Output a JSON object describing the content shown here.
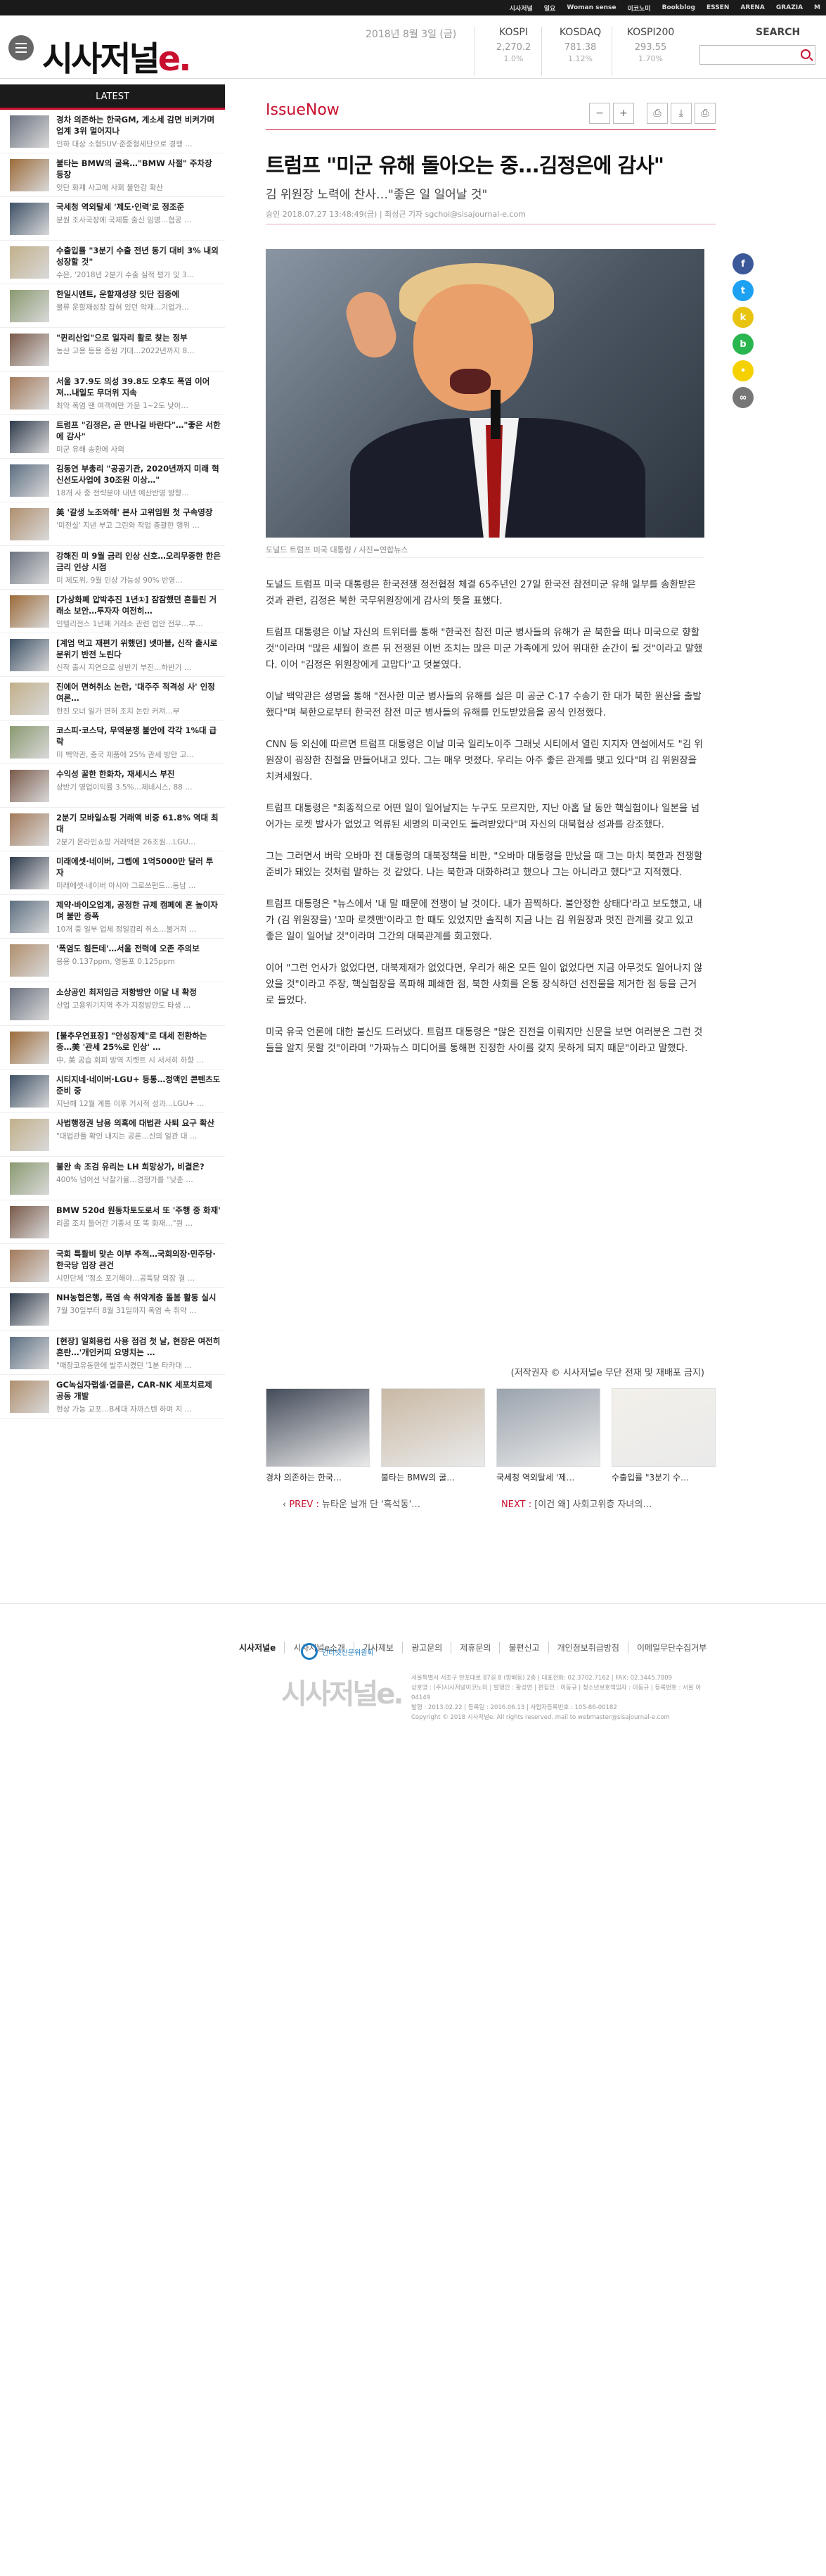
{
  "network_links": [
    "시사저널",
    "일요",
    "Woman sense",
    "이코노미",
    "Bookblog",
    "ESSEN",
    "ARENA",
    "GRAZIA",
    "M"
  ],
  "header": {
    "logo_main": "시사저널",
    "logo_accent": "e.",
    "date": "2018년 8월 3일 (금)",
    "search_title": "SEARCH",
    "search_placeholder": ""
  },
  "markets": [
    {
      "name": "KOSPI",
      "value": "2,270.2",
      "change": "1.0%"
    },
    {
      "name": "KOSDAQ",
      "value": "781.38",
      "change": "1.12%"
    },
    {
      "name": "KOSPI200",
      "value": "293.55",
      "change": "1.70%"
    }
  ],
  "sidebar": {
    "title": "LATEST",
    "items": [
      {
        "title": "경차 의존하는 한국GM, 계소세 감면 비켜가며 업계 3위 멀어지나",
        "summary": "인하 대상 소형SUV·준중형세단으로 경쟁 …"
      },
      {
        "title": "불타는 BMW의 굴욕…\"BMW 사절\" 주차장 등장",
        "summary": "잇단 화재 사고에 사회 불안감 확산"
      },
      {
        "title": "국세청 역외탈세 '제도·인력'로 정조준",
        "summary": "분원 조사국장에 국제통 출신 임명…협공 …"
      },
      {
        "title": "수출입률 \"3분기 수출 전년 동기 대비 3% 내외 성장할 것\"",
        "summary": "수은, '2018년 2분기 수출 실적 평가 및 3…"
      },
      {
        "title": "한일시멘트, 운할재성장 잇단 집중에",
        "summary": "물류 운할재성장 잡혀 있던 악재…기업가…"
      },
      {
        "title": "\"퀸리산업\"으로 일자리 활로 찾는 정부",
        "summary": "농산 고용 등용 증원 기대…2022년까지 8…"
      },
      {
        "title": "서울 37.9도 의성 39.8도 오후도 폭염 이어져…내일도 무더위 지속",
        "summary": "최악 폭염 땐 여객에만 가운 1~2도 낮아…"
      },
      {
        "title": "트럼프 \"김정은, 곧 만나길 바란다\"…\"좋은 서한 에 감사\"",
        "summary": "미군 유해 송환에 사의"
      },
      {
        "title": "김동연 부총리 \"공공기관, 2020년까지 미래 혁신선도사업에 30조원 이상…\"",
        "summary": "18개 사 중 전략분야 내년 예산반영 방향…"
      },
      {
        "title": "美 '갈생 노조와해' 본사 고위임원 첫 구속영장",
        "summary": "'미전실' 지낸 부고 그린와 작업 총괄한 행위 …"
      },
      {
        "title": "강해진 미 9월 금리 인상 신호…오리무중한 한은 금리 인상 시점",
        "summary": "미 제도위, 9월 인상 가능성 90% 반영…"
      },
      {
        "title": "[가상화폐 압박추진 1년①] 잠잠했던 흔들린 거래소 보안…투자자 여전히…",
        "summary": "인텔리전스 1년째 거래소 관련 법안 전무…부…"
      },
      {
        "title": "[계엄 먹고 재편기 위했던] 넷마블, 신작 출시로 분위기 반전 노린다",
        "summary": "신작 출시 지연으로 상반기 부진…하반기 …"
      },
      {
        "title": "진에어 면허취소 논란, '대주주 적격성 사' 인정 여론…",
        "summary": "한진 오너 일가 면허 조치 논란 커져…부"
      },
      {
        "title": "코스피·코스닥, 무역분쟁 불안에 각각 1%대 급락",
        "summary": "미 백악관, 중국 제품에 25% 관세 방안 고…"
      },
      {
        "title": "수익성 꿀한 한화차, 재세시스 부진",
        "summary": "상반기 영업이익률 3.5%…제네시스, 88 …"
      },
      {
        "title": "2분기 모바일쇼핑 거래액 비중 61.8% 역대 최대",
        "summary": "2분기 온라인쇼핑 거래액은 26조원…LGU…"
      },
      {
        "title": "미래에셋·네이버, 그렙에 1억5000만 달러 투자",
        "summary": "미래에셋·네이버 아시아 그로쓰펀드…동남 …"
      },
      {
        "title": "제약·바이오업계, 공정한 규제 캠페에 혼 높이자며 불만 증폭",
        "summary": "10개 중 일부 업체 정일감리 취소…불거져 …"
      },
      {
        "title": "'폭염도 힘든데'…서울 전력에 오존 주의보",
        "summary": "응용 0.137ppm, 영동포 0.125ppm"
      },
      {
        "title": "소상공인 최저임금 저항방안 이달 내 확정",
        "summary": "산업 고용위기지역 추가 지정방안도 타생 …"
      },
      {
        "title": "[불추우연표장] \"안성장제\"로 대세 전환하는 중…美 '관세 25%로 인상' …",
        "summary": "中, 美 공습 회피 방역 지렛트 시 서서히 하향 …"
      },
      {
        "title": "시티지네·네이버·LGU+ 등통…정액인 콘텐츠도 준비 중",
        "summary": "지난해 12월 계통 이후 거시적 성과…LGU+ …"
      },
      {
        "title": "사법행정권 남용 의혹에 대법관 사퇴 요구 확산",
        "summary": "\"대법관들 확인 내지는 공론…신의 일관 대 …"
      },
      {
        "title": "불완 속 조검 유리는 LH 희망상가, 비결은?",
        "summary": "400% 넘어선 낙찰가율…경쟁가를 \"낮춘 …"
      },
      {
        "title": "BMW 520d 원동차토도로서 또 '주행 중 화재'",
        "summary": "리콜 조치 들어간 기종서 또 똑 화재…\"원 …"
      },
      {
        "title": "국회 특활비 맞손 이부 추적…국회의장·민주당·한국당 입장 관건",
        "summary": "시민단체 \"정소 포기해야…공독당 의장 결 …"
      },
      {
        "title": "NH농협은행, 폭염 속 취약계층 돌봄 활동 실시",
        "summary": "7월 30일부터 8월 31일까지 폭염 속 취약 …"
      },
      {
        "title": "[현장] 일회용컵 사용 점검 첫 날, 현장은 여전히 혼란…'개인커피 요명치는 …",
        "summary": "\"매장코유동한에 발주시켰던 '1분 타카대 …"
      },
      {
        "title": "GC녹십자랩셀·엽클론, CAR-NK 세포치료제 공동 개발",
        "summary": "현상 가능 교포…B세대 자까스텐 하며 지 …"
      }
    ]
  },
  "article": {
    "section": "IssueNow",
    "tools": [
      "−",
      "+",
      "⎙",
      "⤓",
      "⎙"
    ],
    "headline": "트럼프 \"미군 유해 돌아오는 중...김정은에 감사\"",
    "subhead": "김 위원장 노력에 찬사…\"좋은 일 일어날 것\"",
    "meta": "승인 2018.07.27 13:48:49(금)  |  최성근 기자 sgchoi@sisajournal-e.com",
    "photo_caption": "도널드 트럼프 미국 대통령 / 사진=연합뉴스",
    "paragraphs": [
      "도널드 트럼프 미국 대통령은 한국전쟁 정전협정 체결 65주년인 27일 한국전 참전미군 유해 일부를 송환받은 것과 관련, 김정은 북한 국무위원장에게 감사의 뜻을 표했다.",
      "트럼프 대통령은 이날 자신의 트위터를 통해 \"한국전 참전 미군 병사들의 유해가 곧 북한을 떠나 미국으로 향할 것\"이라며 \"많은 세월이 흐른 뒤 전쟁된 이번 조치는 많은 미군 가족에게 있어 위대한 순간이 될 것\"이라고 말했다. 이어 \"김정은 위원장에게 고맙다\"고 덧붙였다.",
      "이날 백악관은 성명을 통해 \"전사한 미군 병사들의 유해를 실은 미 공군 C-17 수송기 한 대가 북한 원산을 출발했다\"며 북한으로부터 한국전 참전 미군 병사들의 유해를 인도받았음을 공식 인정했다.",
      "CNN 등 외신에 따르면 트럼프 대통령은 이날 미국 일리노이주 그래닛 시티에서 열린 지지자 연설에서도 \"김 위원장이 굉장한 친절을 만들어내고 있다. 그는 매우 멋졌다. 우리는 아주 좋은 관계를 맺고 있다\"며 김 위원장을 치켜세웠다.",
      "트럼프 대통령은 \"최종적으로 어떤 일이 일어날지는 누구도 모르지만, 지난 아홉 달 동안 핵실험이나 일본을 넘어가는 로켓 발사가 없었고 억류된 세명의 미국인도 돌려받았다\"며 자신의 대북협상 성과를 강조했다.",
      "그는 그러면서 버락 오바마 전 대통령의 대북정책을 비판, \"오바마 대통령을 만났을 때 그는 마치 북한과 전쟁할 준비가 돼있는 것처럼 말하는 것 같았다. 나는 북한과 대화하려고 했으나 그는 아니라고 했다\"고 지적했다.",
      "트럼프 대통령은 \"뉴스에서 '내 말 때문에 전쟁이 날 것이다. 내가 끔찍하다. 불안정한 상태다'라고 보도했고, 내가 (김 위원장을) '꼬마 로켓맨'이라고 한 때도 있었지만 솔직히 지금 나는 김 위원장과 멋진 관계를 갖고 있고 좋은 일이 일어날 것\"이라며 그간의 대북관계를 회고했다.",
      "이어 \"그런 언사가 없었다면, 대북제재가 없었다면, 우리가 해온 모든 일이 없었다면 지금 아무것도 일어나지 않았을 것\"이라고 주장, 핵실험장을 폭파해 폐쇄한 점, 북한 사회를 온통 장식하던 선전물을 제거한 점 등을 근거로 들었다.",
      "미국 유국 언론에 대한 불신도 드러냈다. 트럼프 대통령은 \"많은 진전을 이뤄지만 신문을 보면 여러분은 그런 것들을 알지 못할 것\"이라며 \"가짜뉴스 미디어를 통해편 진정한 사이를 갖지 못하게 되지 때문\"이라고 말했다."
    ],
    "copyright": "(저작권자 © 시사저널e 무단 전재 및 재배포 금지)"
  },
  "share_buttons": [
    {
      "name": "facebook-icon",
      "glyph": "f",
      "color": "#3b5998"
    },
    {
      "name": "twitter-icon",
      "glyph": "t",
      "color": "#1da1f2"
    },
    {
      "name": "kakaostory-icon",
      "glyph": "k",
      "color": "#e8c310"
    },
    {
      "name": "band-icon",
      "glyph": "b",
      "color": "#29b64f"
    },
    {
      "name": "kakaotalk-icon",
      "glyph": "•",
      "color": "#f5d100"
    },
    {
      "name": "link-icon",
      "glyph": "∞",
      "color": "#777777"
    }
  ],
  "related": [
    {
      "title": "경차 의존하는 한국…",
      "tone": "#444c5a"
    },
    {
      "title": "불타는 BMW의 굴…",
      "tone": "#c9b9a4"
    },
    {
      "title": "국세청 역외탈세 '제…",
      "tone": "#9aa3ad"
    },
    {
      "title": "수출입률 \"3분기 수…",
      "tone": "#f3f0ea"
    }
  ],
  "prev": {
    "label": "PREV :",
    "text": "뉴타운 날개 단 '흑석동'…"
  },
  "next": {
    "label": "NEXT :",
    "text": "[이건 왜] 사회고위층 자녀의…"
  },
  "footer": {
    "nav": [
      "시사저널e",
      "시사저널e소개",
      "기사제보",
      "광고문의",
      "제휴문의",
      "불편신고",
      "개인정보취급방침",
      "이메일무단수집거부"
    ],
    "badge": "인터넷신문위원회",
    "logo": "시사저널e.",
    "info": [
      "서울특별시 서초구 반포대로 87길 8 (방배동) 2층 | 대표전화: 02.3702.7162 | FAX: 02.3445.7809",
      "상호명 : (주)시사저널이코노미 | 발행인 : 황성연 | 편집인 : 이동규 | 청소년보호책임자 : 이동규 | 등록번호 : 서울 아 04149",
      "발행 : 2013.02.22 | 등록일 : 2016.06.13 | 사업자등록번호 : 105-86-00182",
      "Copyright © 2018 시사저널e. All rights reserved. mail to webmaster@sisajournal-e.com"
    ]
  }
}
